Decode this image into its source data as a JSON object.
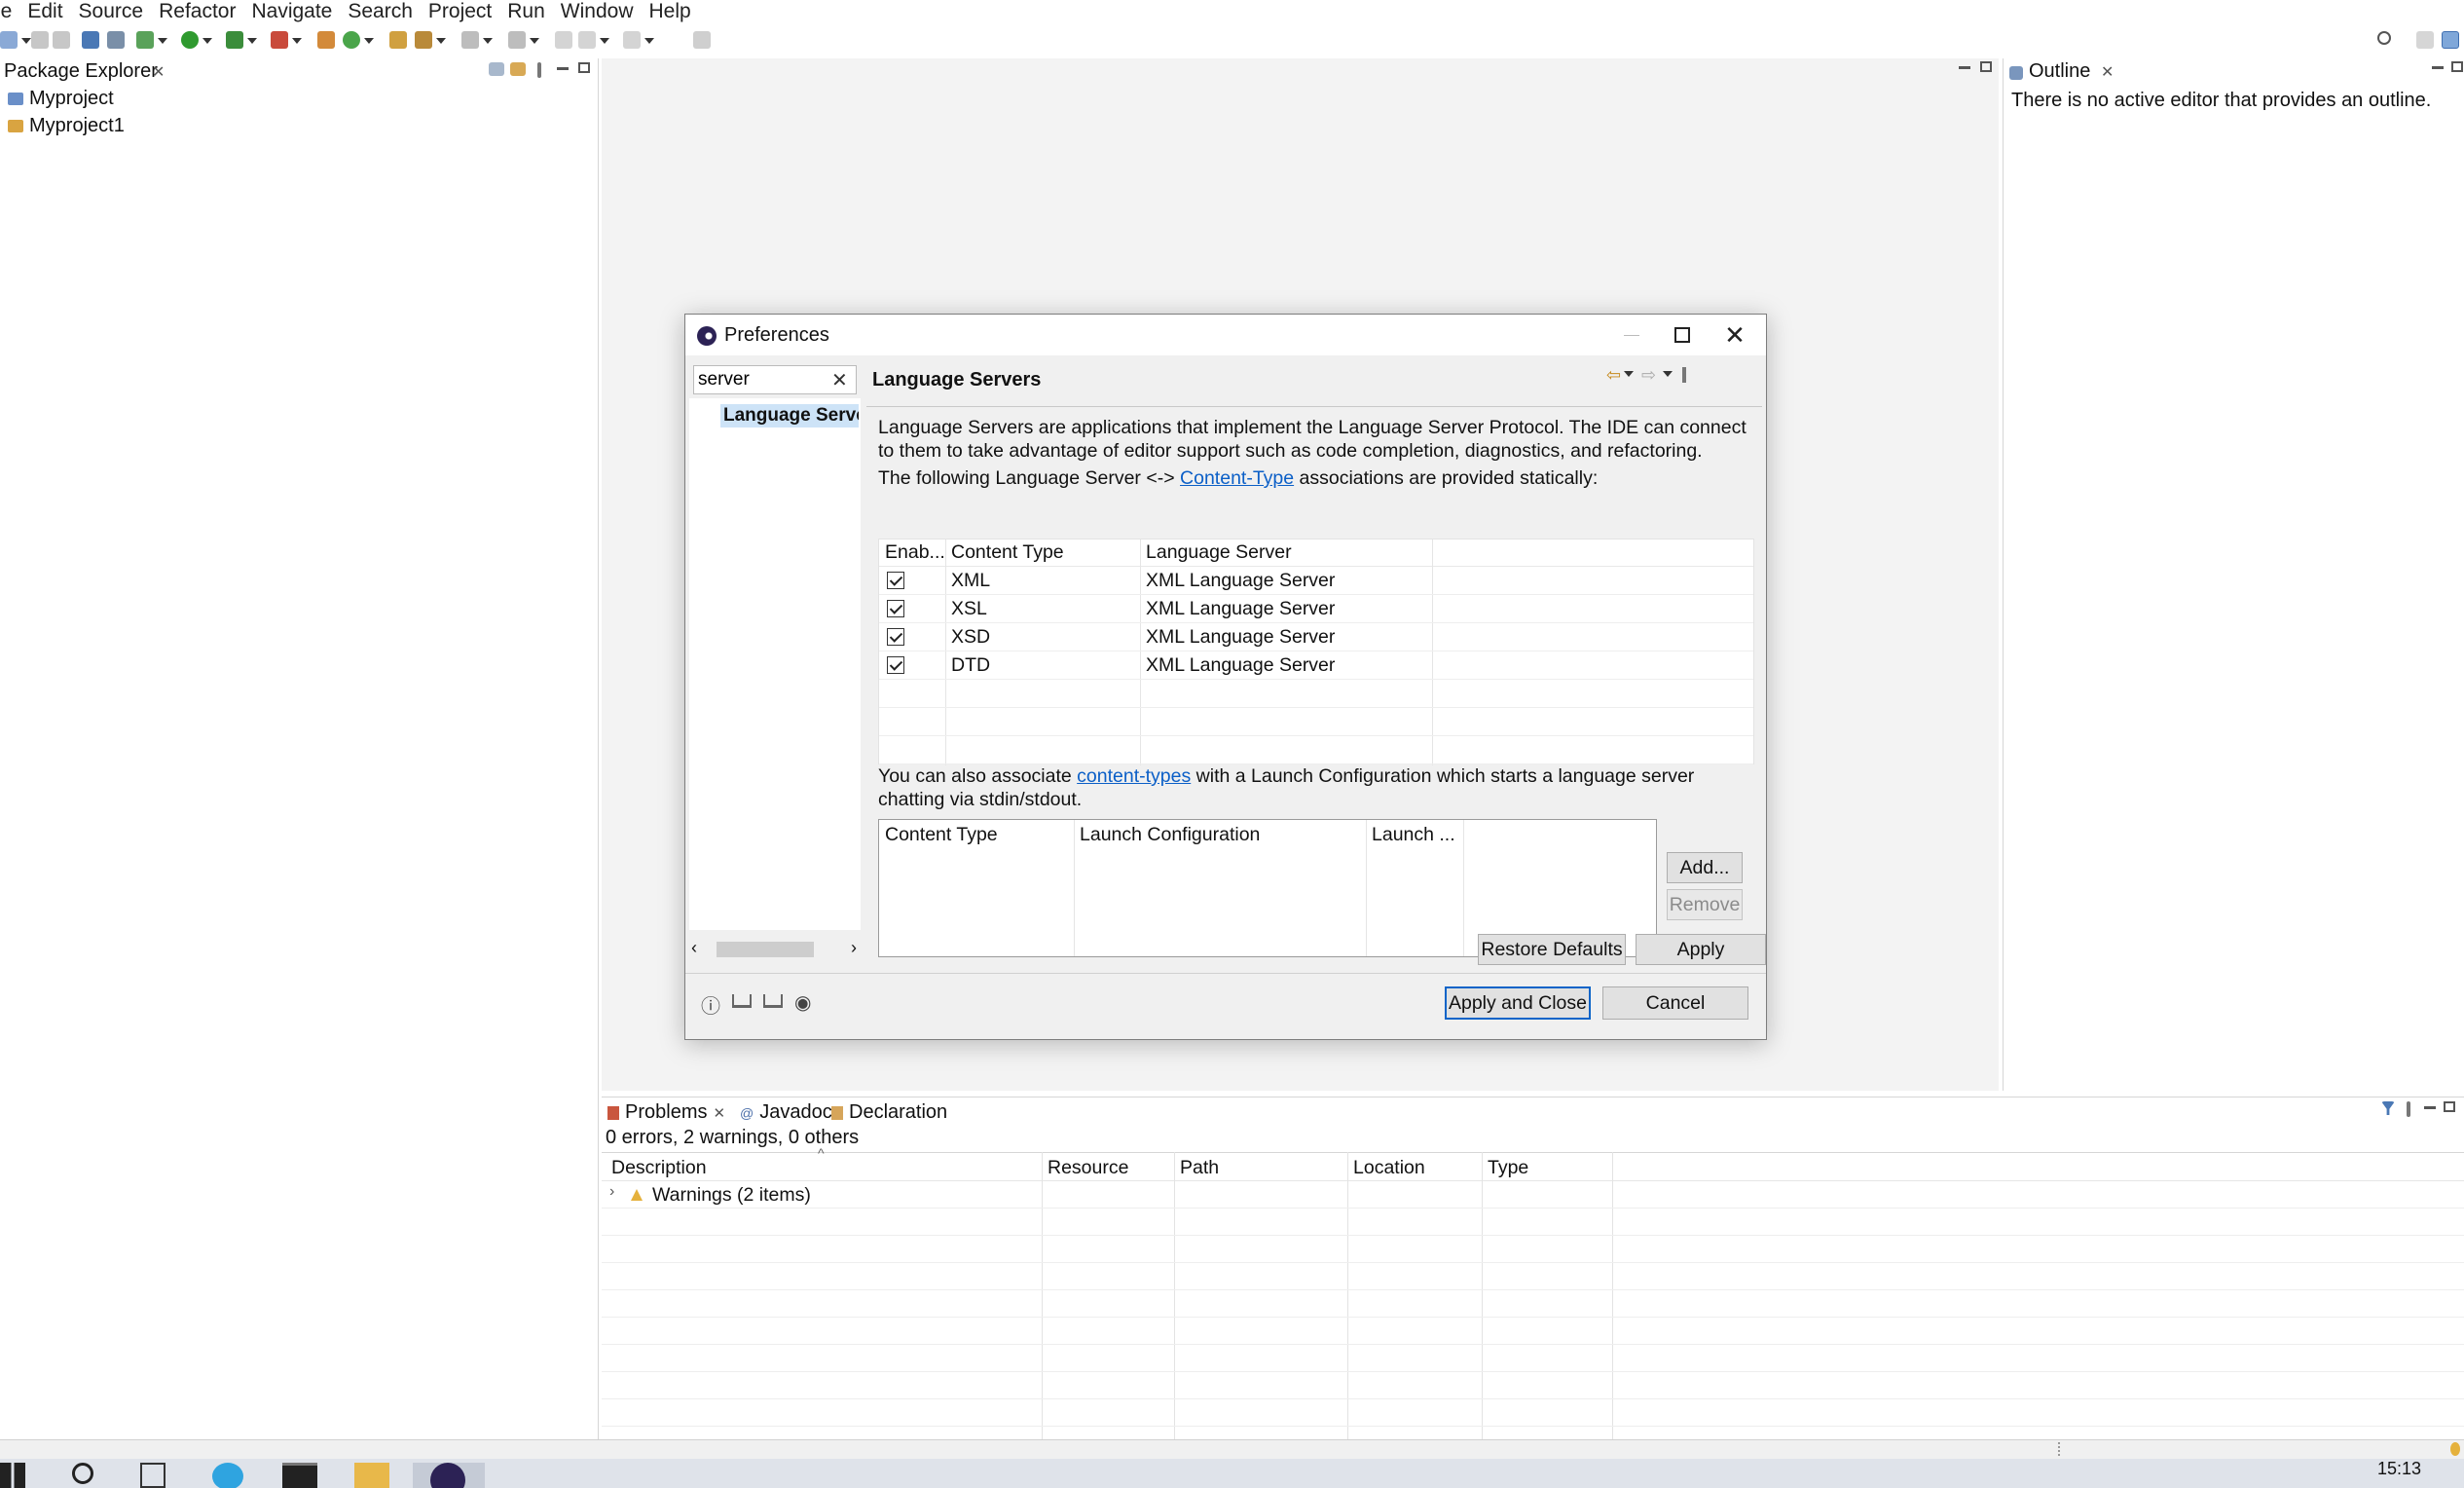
{
  "menu": [
    "le",
    "Edit",
    "Source",
    "Refactor",
    "Navigate",
    "Search",
    "Project",
    "Run",
    "Window",
    "Help"
  ],
  "package_explorer": {
    "tab_label": "Package Explorer",
    "items": [
      "Myproject",
      "Myproject1"
    ]
  },
  "outline": {
    "tab_label": "Outline",
    "message": "There is no active editor that provides an outline."
  },
  "dialog": {
    "title": "Preferences",
    "search_value": "server",
    "nav_selected": "Language Servers",
    "page_title": "Language Servers",
    "desc1": "Language Servers are applications that implement the Language Server Protocol. The IDE can connect to them to take advantage of editor support such as code completion, diagnostics, and refactoring.",
    "desc2_pre": "The following Language Server <-> ",
    "desc2_link": "Content-Type",
    "desc2_post": " associations are provided statically:",
    "ls_table": {
      "headers": [
        "Enab...",
        "Content Type",
        "Language Server"
      ],
      "rows": [
        {
          "enabled": true,
          "content_type": "XML",
          "server": "XML Language Server"
        },
        {
          "enabled": true,
          "content_type": "XSL",
          "server": "XML Language Server"
        },
        {
          "enabled": true,
          "content_type": "XSD",
          "server": "XML Language Server"
        },
        {
          "enabled": true,
          "content_type": "DTD",
          "server": "XML Language Server"
        }
      ]
    },
    "desc3_pre": "You can also associate ",
    "desc3_link": "content-types",
    "desc3_post": " with a Launch Configuration which starts a language server chatting via stdin/stdout.",
    "lc_table": {
      "headers": [
        "Content Type",
        "Launch Configuration",
        "Launch ..."
      ]
    },
    "buttons": {
      "add": "Add...",
      "remove": "Remove",
      "restore": "Restore Defaults",
      "apply": "Apply",
      "apply_close": "Apply and Close",
      "cancel": "Cancel"
    }
  },
  "problems": {
    "tabs": [
      "Problems",
      "Javadoc",
      "Declaration"
    ],
    "summary": "0 errors, 2 warnings, 0 others",
    "headers": [
      "Description",
      "Resource",
      "Path",
      "Location",
      "Type"
    ],
    "rows": [
      "Warnings (2 items)"
    ]
  },
  "clock": "15:13",
  "colors": {
    "accent": "#0a64c8",
    "link": "#0b5fc7",
    "selection": "#cde3f7"
  }
}
